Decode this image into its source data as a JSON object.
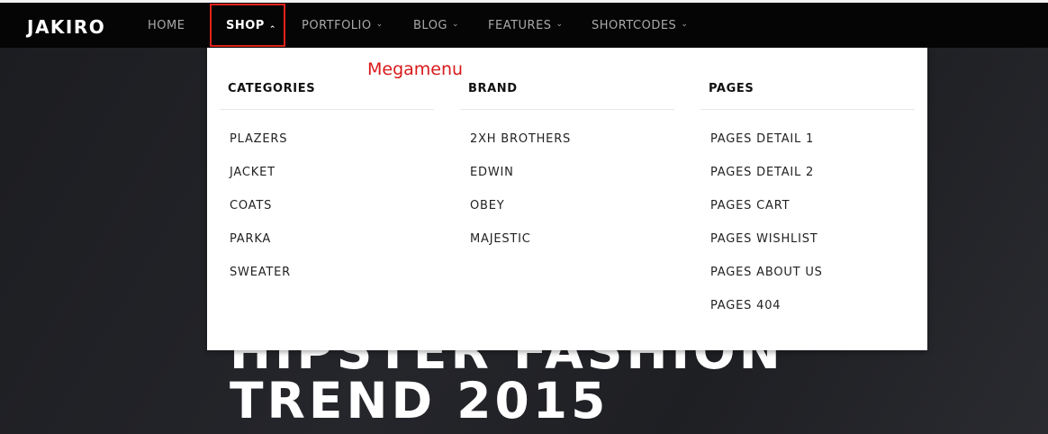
{
  "brand": {
    "name": "JAKIRO"
  },
  "nav": {
    "items": [
      {
        "label": "HOME",
        "has_dropdown": false
      },
      {
        "label": "SHOP",
        "has_dropdown": true,
        "expanded": true
      },
      {
        "label": "PORTFOLIO",
        "has_dropdown": true
      },
      {
        "label": "BLOG",
        "has_dropdown": true
      },
      {
        "label": "FEATURES",
        "has_dropdown": true
      },
      {
        "label": "SHORTCODES",
        "has_dropdown": true
      }
    ],
    "chevron_down": "⌄",
    "chevron_up": "⌃"
  },
  "megamenu": {
    "annotation": "Megamenu",
    "columns": [
      {
        "title": "CATEGORIES",
        "links": [
          "PLAZERS",
          "JACKET",
          "COATS",
          "PARKA",
          "SWEATER"
        ]
      },
      {
        "title": "BRAND",
        "links": [
          "2XH BROTHERS",
          "EDWIN",
          "OBEY",
          "MAJESTIC"
        ]
      },
      {
        "title": "PAGES",
        "links": [
          "PAGES DETAIL 1",
          "PAGES DETAIL 2",
          "PAGES CART",
          "PAGES WISHLIST",
          "PAGES ABOUT US",
          "PAGES 404"
        ]
      }
    ]
  },
  "hero": {
    "line1": "HIPSTER FASHION",
    "line2": "TREND 2015"
  },
  "colors": {
    "navbar": "#050505",
    "annotation": "#e2231a",
    "hero_bg": "#1f2024"
  }
}
